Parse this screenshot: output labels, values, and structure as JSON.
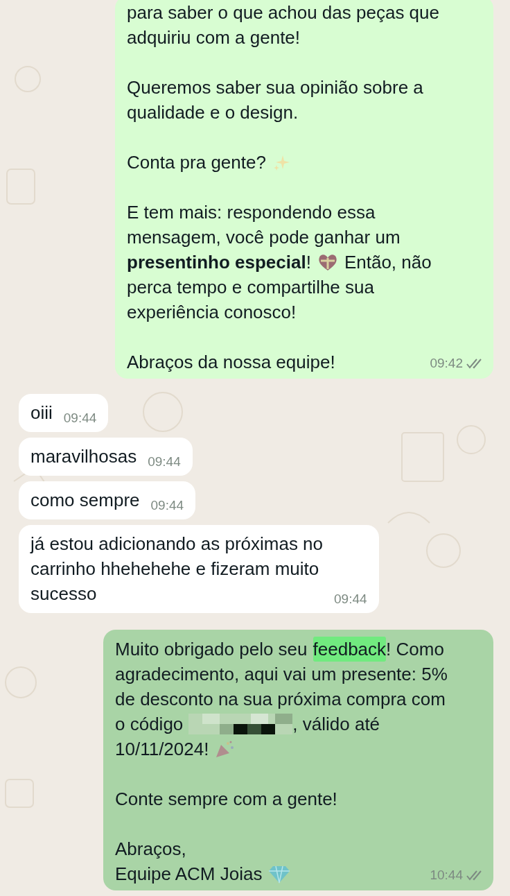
{
  "messages": [
    {
      "kind": "outgoing",
      "selected": false,
      "time": "09:42",
      "read": false,
      "paragraphs": [
        [
          [
            {
              "kind": "text",
              "text": "para saber o que achou das peças que"
            }
          ],
          [
            {
              "kind": "text",
              "text": "adquiriu com a gente!"
            }
          ]
        ],
        [
          [
            {
              "kind": "text",
              "text": "Queremos saber sua opinião sobre a"
            }
          ],
          [
            {
              "kind": "text",
              "text": "qualidade e o design."
            }
          ]
        ],
        [
          [
            {
              "kind": "text",
              "text": "Conta pra gente?"
            },
            {
              "kind": "sparkles"
            }
          ]
        ],
        [
          [
            {
              "kind": "text",
              "text": "E tem mais: respondendo essa"
            }
          ],
          [
            {
              "kind": "text",
              "text": "mensagem, você pode ganhar um"
            }
          ],
          [
            {
              "kind": "text",
              "text": "**presentinho especial**!"
            },
            {
              "kind": "heart"
            },
            {
              "kind": "text",
              "text": "Então, não"
            }
          ],
          [
            {
              "kind": "text",
              "text": "perca tempo e compartilhe sua"
            }
          ],
          [
            {
              "kind": "text",
              "text": "experiência conosco!"
            }
          ]
        ],
        [
          [
            {
              "kind": "text",
              "text": "Abraços da nossa equipe!"
            }
          ]
        ]
      ]
    },
    {
      "kind": "incoming",
      "selected": false,
      "time": "09:44",
      "paragraphs": [
        [
          [
            {
              "kind": "text",
              "text": "oiii"
            }
          ]
        ]
      ]
    },
    {
      "kind": "incoming",
      "selected": false,
      "time": "09:44",
      "paragraphs": [
        [
          [
            {
              "kind": "text",
              "text": "maravilhosas"
            }
          ]
        ]
      ]
    },
    {
      "kind": "incoming",
      "selected": false,
      "time": "09:44",
      "paragraphs": [
        [
          [
            {
              "kind": "text",
              "text": "como sempre"
            }
          ]
        ]
      ]
    },
    {
      "kind": "incoming",
      "selected": false,
      "time": "09:44",
      "paragraphs": [
        [
          [
            {
              "kind": "text",
              "text": "já estou adicionando as próximas no"
            }
          ],
          [
            {
              "kind": "text",
              "text": "carrinho hhehehehe e fizeram muito"
            }
          ],
          [
            {
              "kind": "text",
              "text": "sucesso"
            }
          ]
        ]
      ]
    },
    {
      "kind": "outgoing",
      "selected": true,
      "time": "10:44",
      "read": false,
      "paragraphs": [
        [
          [
            {
              "kind": "text",
              "text": "Muito obrigado pelo seu"
            },
            {
              "kind": "highlight",
              "text": "feedback"
            },
            {
              "kind": "text",
              "text": "! Como"
            }
          ],
          [
            {
              "kind": "text",
              "text": "agradecimento, aqui vai um presente: 5%"
            }
          ],
          [
            {
              "kind": "text",
              "text": "de desconto na sua próxima compra com"
            }
          ],
          [
            {
              "kind": "text",
              "text": "o código"
            },
            {
              "kind": "redacted"
            },
            {
              "kind": "text",
              "text": ", válido até"
            }
          ],
          [
            {
              "kind": "text",
              "text": "10/11/2024!"
            },
            {
              "kind": "popper"
            }
          ]
        ],
        [
          [
            {
              "kind": "text",
              "text": "Conte sempre com a gente!"
            }
          ]
        ],
        [
          [
            {
              "kind": "text",
              "text": "Abraços,"
            }
          ],
          [
            {
              "kind": "text",
              "text": "Equipe ACM Joias"
            },
            {
              "kind": "diamond"
            }
          ]
        ]
      ]
    }
  ]
}
